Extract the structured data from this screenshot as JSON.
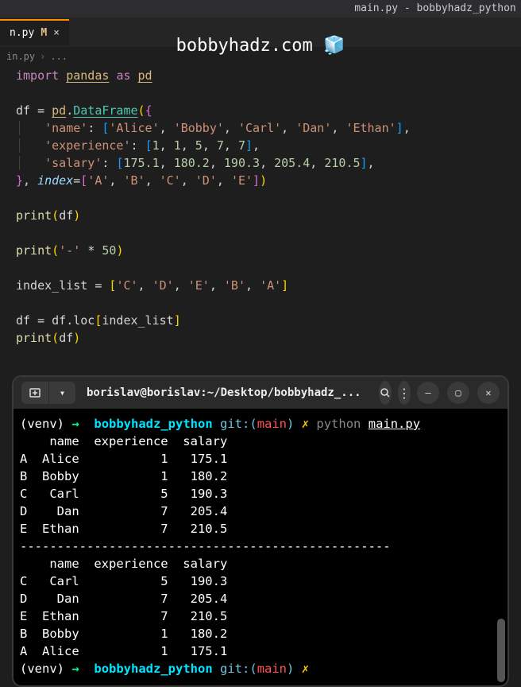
{
  "titleBar": "main.py - bobbyhadz_python",
  "tab": {
    "filename": "n.py",
    "modified": "M",
    "close": "×"
  },
  "watermark": "bobbyhadz.com",
  "watermarkIcon": "🧊",
  "breadcrumb": {
    "file": "in.py",
    "sep1": "›",
    "more": "..."
  },
  "code": {
    "kw_import": "import",
    "module_pandas": "pandas",
    "kw_as": "as",
    "alias_pd": "pd",
    "var_df": "df",
    "op_eq": "=",
    "obj_pd": "pd",
    "method_dataframe": "DataFrame",
    "key_name": "'name'",
    "val_names": "['Alice', 'Bobby', 'Carl', 'Dan', 'Ethan']",
    "key_experience": "'experience'",
    "val_exp": "[1, 1, 5, 7, 7]",
    "key_salary": "'salary'",
    "val_salary": "[175.1, 180.2, 190.3, 205.4, 210.5]",
    "kwarg_index": "index",
    "val_index": "['A', 'B', 'C', 'D', 'E']",
    "func_print": "print",
    "arg_df": "df",
    "str_dash": "'-'",
    "op_star": "*",
    "num_50": "50",
    "var_indexlist": "index_list",
    "val_indexlist": "['C', 'D', 'E', 'B', 'A']",
    "prop_loc": "loc",
    "ref_indexlist": "index_list"
  },
  "terminal": {
    "toolbar": {
      "new_tab": "+",
      "dropdown": "▾",
      "path": "borislav@borislav:~/Desktop/bobbyhadz_...",
      "search": "🔍",
      "menu": "⋮",
      "minimize": "—",
      "maximize": "▢",
      "close": "✕"
    },
    "prompt1": {
      "venv": "(venv)",
      "arrow": "→",
      "dir": "bobbyhadz_python",
      "git": "git:(",
      "branch": "main",
      "paren_close": ")",
      "x": "✗",
      "cmd": "python",
      "file": "main.py"
    },
    "output1": {
      "header": "    name  experience  salary",
      "rows": [
        "A  Alice           1   175.1",
        "B  Bobby           1   180.2",
        "C   Carl           5   190.3",
        "D    Dan           7   205.4",
        "E  Ethan           7   210.5"
      ]
    },
    "separator": "--------------------------------------------------",
    "output2": {
      "header": "    name  experience  salary",
      "rows": [
        "C   Carl           5   190.3",
        "D    Dan           7   205.4",
        "E  Ethan           7   210.5",
        "B  Bobby           1   180.2",
        "A  Alice           1   175.1"
      ]
    },
    "prompt2": {
      "venv": "(venv)",
      "arrow": "→",
      "dir": "bobbyhadz_python",
      "git": "git:(",
      "branch": "main",
      "paren_close": ")",
      "x": "✗"
    }
  }
}
